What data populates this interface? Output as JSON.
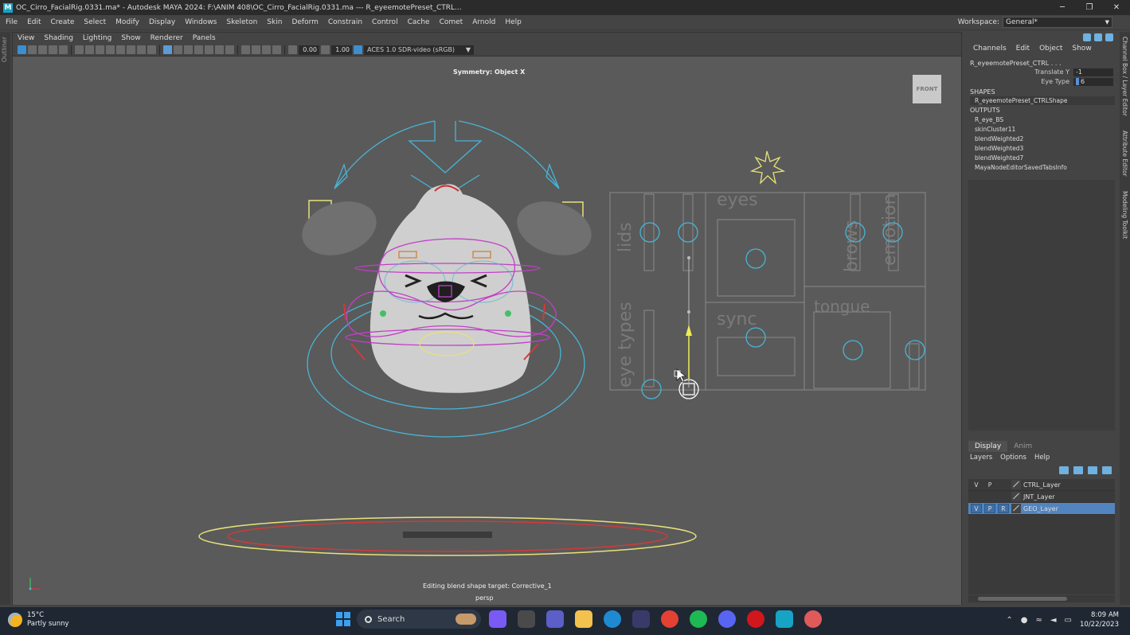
{
  "window": {
    "logo": "M",
    "title": "OC_Cirro_FacialRig.0331.ma* - Autodesk MAYA 2024: F:\\ANIM 408\\OC_Cirro_FacialRig.0331.ma   ---   R_eyeemotePreset_CTRL...",
    "minimize": "─",
    "maximize": "❐",
    "close": "✕"
  },
  "menubar": {
    "items": [
      "File",
      "Edit",
      "Create",
      "Select",
      "Modify",
      "Display",
      "Windows",
      "Skeleton",
      "Skin",
      "Deform",
      "Constrain",
      "Control",
      "Cache",
      "Comet",
      "Arnold",
      "Help"
    ],
    "workspace_label": "Workspace:",
    "workspace_value": "General*"
  },
  "left_strip": {
    "label": "Outliner"
  },
  "viewport_panel": {
    "menus": [
      "View",
      "Shading",
      "Lighting",
      "Show",
      "Renderer",
      "Panels"
    ],
    "exposure": "0.00",
    "gamma": "1.00",
    "color_space": "ACES 1.0 SDR-video (sRGB)",
    "symmetry": "Symmetry: Object X",
    "view_cube": "FRONT",
    "status": "Editing blend shape target: Corrective_1",
    "camera": "persp",
    "picker_labels": {
      "eyes": "eyes",
      "lids": "lids",
      "brows": "brows",
      "emotion": "emotion",
      "eye_types": "eye types",
      "sync": "sync",
      "tongue": "tongue"
    }
  },
  "channel_box": {
    "menus": [
      "Channels",
      "Edit",
      "Object",
      "Show"
    ],
    "node": "R_eyeemotePreset_CTRL . . .",
    "attributes": [
      {
        "label": "Translate Y",
        "value": "-1"
      },
      {
        "label": "Eye Type",
        "value": "6"
      }
    ],
    "shapes_header": "SHAPES",
    "shape": "R_eyeemotePreset_CTRLShape",
    "outputs_header": "OUTPUTS",
    "outputs": [
      "R_eye_BS",
      "skinCluster11",
      "blendWeighted2",
      "blendWeighted3",
      "blendWeighted7",
      "MayaNodeEditorSavedTabsInfo"
    ]
  },
  "right_tabs": [
    "Channel Box / Layer Editor",
    "Attribute Editor",
    "Modeling Toolkit"
  ],
  "layer_editor": {
    "tabs": [
      "Display",
      "Anim"
    ],
    "menus": [
      "Layers",
      "Options",
      "Help"
    ],
    "layers": [
      {
        "v": "V",
        "p": "P",
        "r": "",
        "name": "CTRL_Layer",
        "selected": false
      },
      {
        "v": "",
        "p": "",
        "r": "",
        "name": "JNT_Layer",
        "selected": false
      },
      {
        "v": "V",
        "p": "P",
        "r": "R",
        "name": "GEO_Layer",
        "selected": true
      }
    ]
  },
  "taskbar": {
    "temperature": "15°C",
    "weather": "Partly sunny",
    "search_placeholder": "Search",
    "time": "8:09 AM",
    "date": "10/22/2023"
  },
  "colors": {
    "viewport_bg": "#5a5a5a",
    "ctrl_cyan": "#48b4d6",
    "ctrl_magenta": "#c23fc6",
    "ctrl_yellow": "#e8e27a",
    "ctrl_red": "#d23a3a",
    "selection_blue": "#5285c0"
  }
}
